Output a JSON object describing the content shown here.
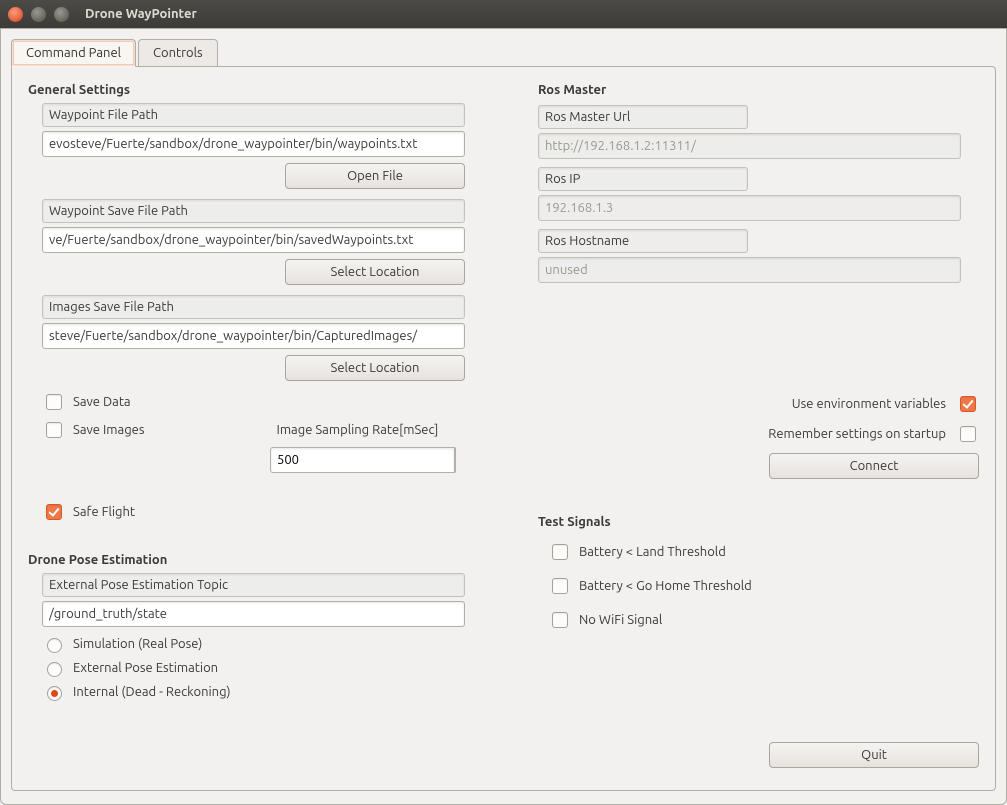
{
  "window": {
    "title": "Drone WayPointer"
  },
  "tabs": {
    "command": "Command Panel",
    "controls": "Controls"
  },
  "general": {
    "title": "General Settings",
    "waypoint_file_label": "Waypoint File Path",
    "waypoint_file_value": "evosteve/Fuerte/sandbox/drone_waypointer/bin/waypoints.txt",
    "open_file": "Open File",
    "waypoint_save_label": "Waypoint Save File Path",
    "waypoint_save_value": "ve/Fuerte/sandbox/drone_waypointer/bin/savedWaypoints.txt",
    "select_location": "Select Location",
    "images_save_label": "Images Save File Path",
    "images_save_value": "steve/Fuerte/sandbox/drone_waypointer/bin/CapturedImages/",
    "save_data": "Save Data",
    "save_images": "Save Images",
    "sampling_rate_label": "Image Sampling Rate[mSec]",
    "sampling_rate_value": "500",
    "safe_flight": "Safe Flight"
  },
  "pose": {
    "title": "Drone Pose Estimation",
    "topic_label": "External Pose Estimation Topic",
    "topic_value": "/ground_truth/state",
    "sim": "Simulation (Real Pose)",
    "ext": "External Pose Estimation",
    "internal": "Internal (Dead - Reckoning)"
  },
  "ros": {
    "title": "Ros Master",
    "url_label": "Ros Master Url",
    "url_value": "http://192.168.1.2:11311/",
    "ip_label": "Ros IP",
    "ip_value": "192.168.1.3",
    "host_label": "Ros Hostname",
    "host_value": "unused",
    "use_env": "Use environment variables",
    "remember": "Remember settings on startup",
    "connect": "Connect"
  },
  "test": {
    "title": "Test Signals",
    "batt_land": "Battery < Land Threshold",
    "batt_home": "Battery < Go Home Threshold",
    "no_wifi": "No WiFi Signal"
  },
  "quit": "Quit"
}
